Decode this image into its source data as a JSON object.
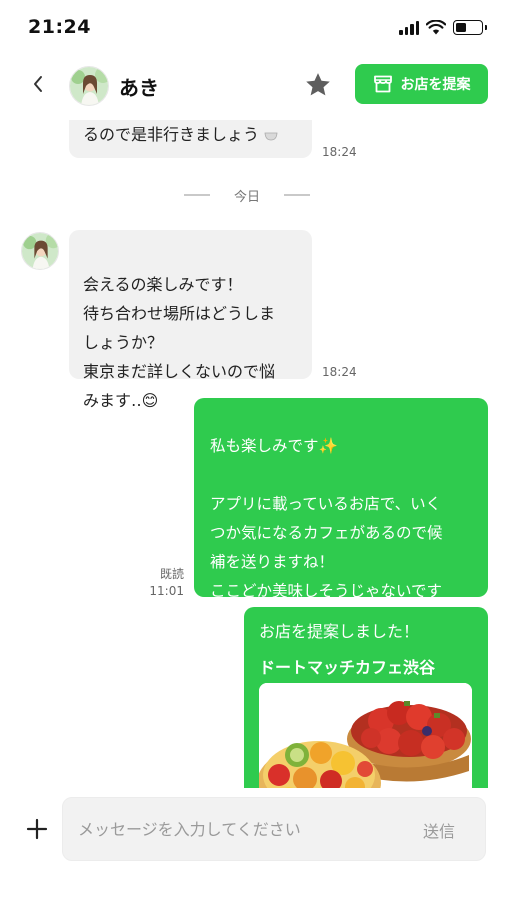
{
  "status_bar": {
    "time": "21:24"
  },
  "header": {
    "contact_name": "あき",
    "suggest_shop_label": "お店を提案"
  },
  "messages": [
    {
      "text": "るので是非行きましょう",
      "time": "18:24"
    },
    {
      "text": "会えるの楽しみです！\n待ち合わせ場所はどうしま\nしょうか？\n東京まだ詳しくないので悩\nみます‥😊",
      "time": "18:24"
    },
    {
      "text": "私も楽しみです✨\n\nアプリに載っているお店で、いく\nつか気になるカフェがあるので候\n補を送りますね！\nここどか美味しそうじゃないです\nか？",
      "read": "既読",
      "time": "11:01"
    }
  ],
  "date_separator": "今日",
  "shop_card": {
    "intro": "お店を提案しました！",
    "shop_name": "ドートマッチカフェ渋谷"
  },
  "input": {
    "placeholder": "メッセージを入力してください",
    "send_label": "送信"
  },
  "colors": {
    "accent": "#2fcb4e",
    "incoming_bubble": "#f1f1f1"
  }
}
